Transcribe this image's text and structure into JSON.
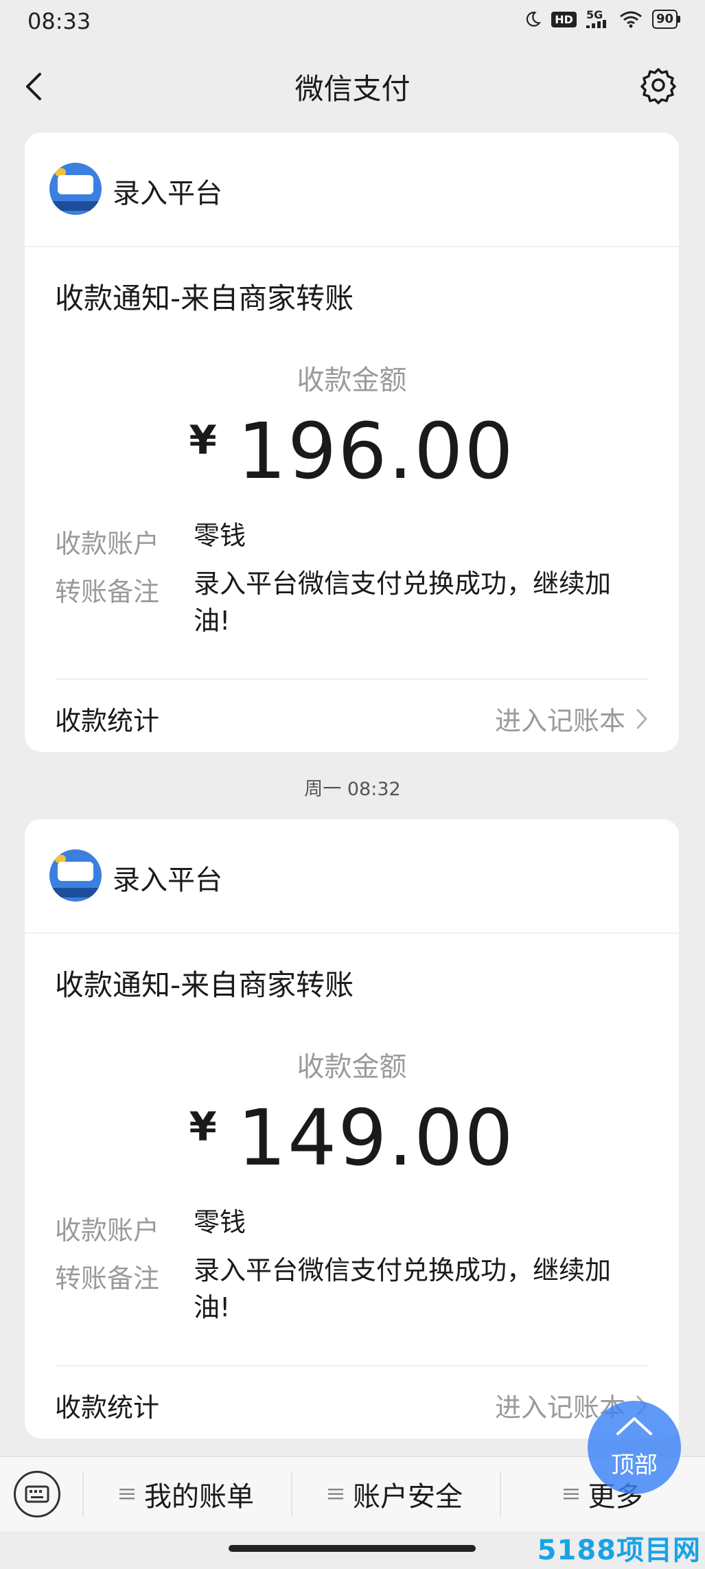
{
  "status_bar": {
    "time": "08:33",
    "network": "5G",
    "hd": "HD",
    "battery": "90"
  },
  "header": {
    "title": "微信支付"
  },
  "messages": [
    {
      "merchant": "录入平台",
      "notice_title": "收款通知-来自商家转账",
      "amount_label": "收款金额",
      "currency": "¥",
      "amount": "196.00",
      "account_label": "收款账户",
      "account_value": "零钱",
      "remark_label": "转账备注",
      "remark_value": "录入平台微信支付兑换成功，继续加油!",
      "stats_label": "收款统计",
      "stats_link": "进入记账本"
    },
    {
      "merchant": "录入平台",
      "notice_title": "收款通知-来自商家转账",
      "amount_label": "收款金额",
      "currency": "¥",
      "amount": "149.00",
      "account_label": "收款账户",
      "account_value": "零钱",
      "remark_label": "转账备注",
      "remark_value": "录入平台微信支付兑换成功，继续加油!",
      "stats_label": "收款统计",
      "stats_link": "进入记账本"
    }
  ],
  "timestamp": "周一 08:32",
  "top_button_label": "顶部",
  "bottom_tabs": [
    {
      "label": "我的账单"
    },
    {
      "label": "账户安全"
    },
    {
      "label": "更多"
    }
  ],
  "watermark": "5188项目网",
  "colors": {
    "background": "#ededed",
    "card": "#ffffff",
    "muted_text": "#9a9a9a",
    "accent_blue": "#3b82f6",
    "watermark": "#19a3e6"
  },
  "icons": {
    "back": "chevron-left-icon",
    "settings": "gear-icon",
    "keyboard": "keyboard-icon",
    "menu": "menu-icon",
    "chevron": "chevron-right-icon",
    "up": "chevron-up-icon"
  }
}
